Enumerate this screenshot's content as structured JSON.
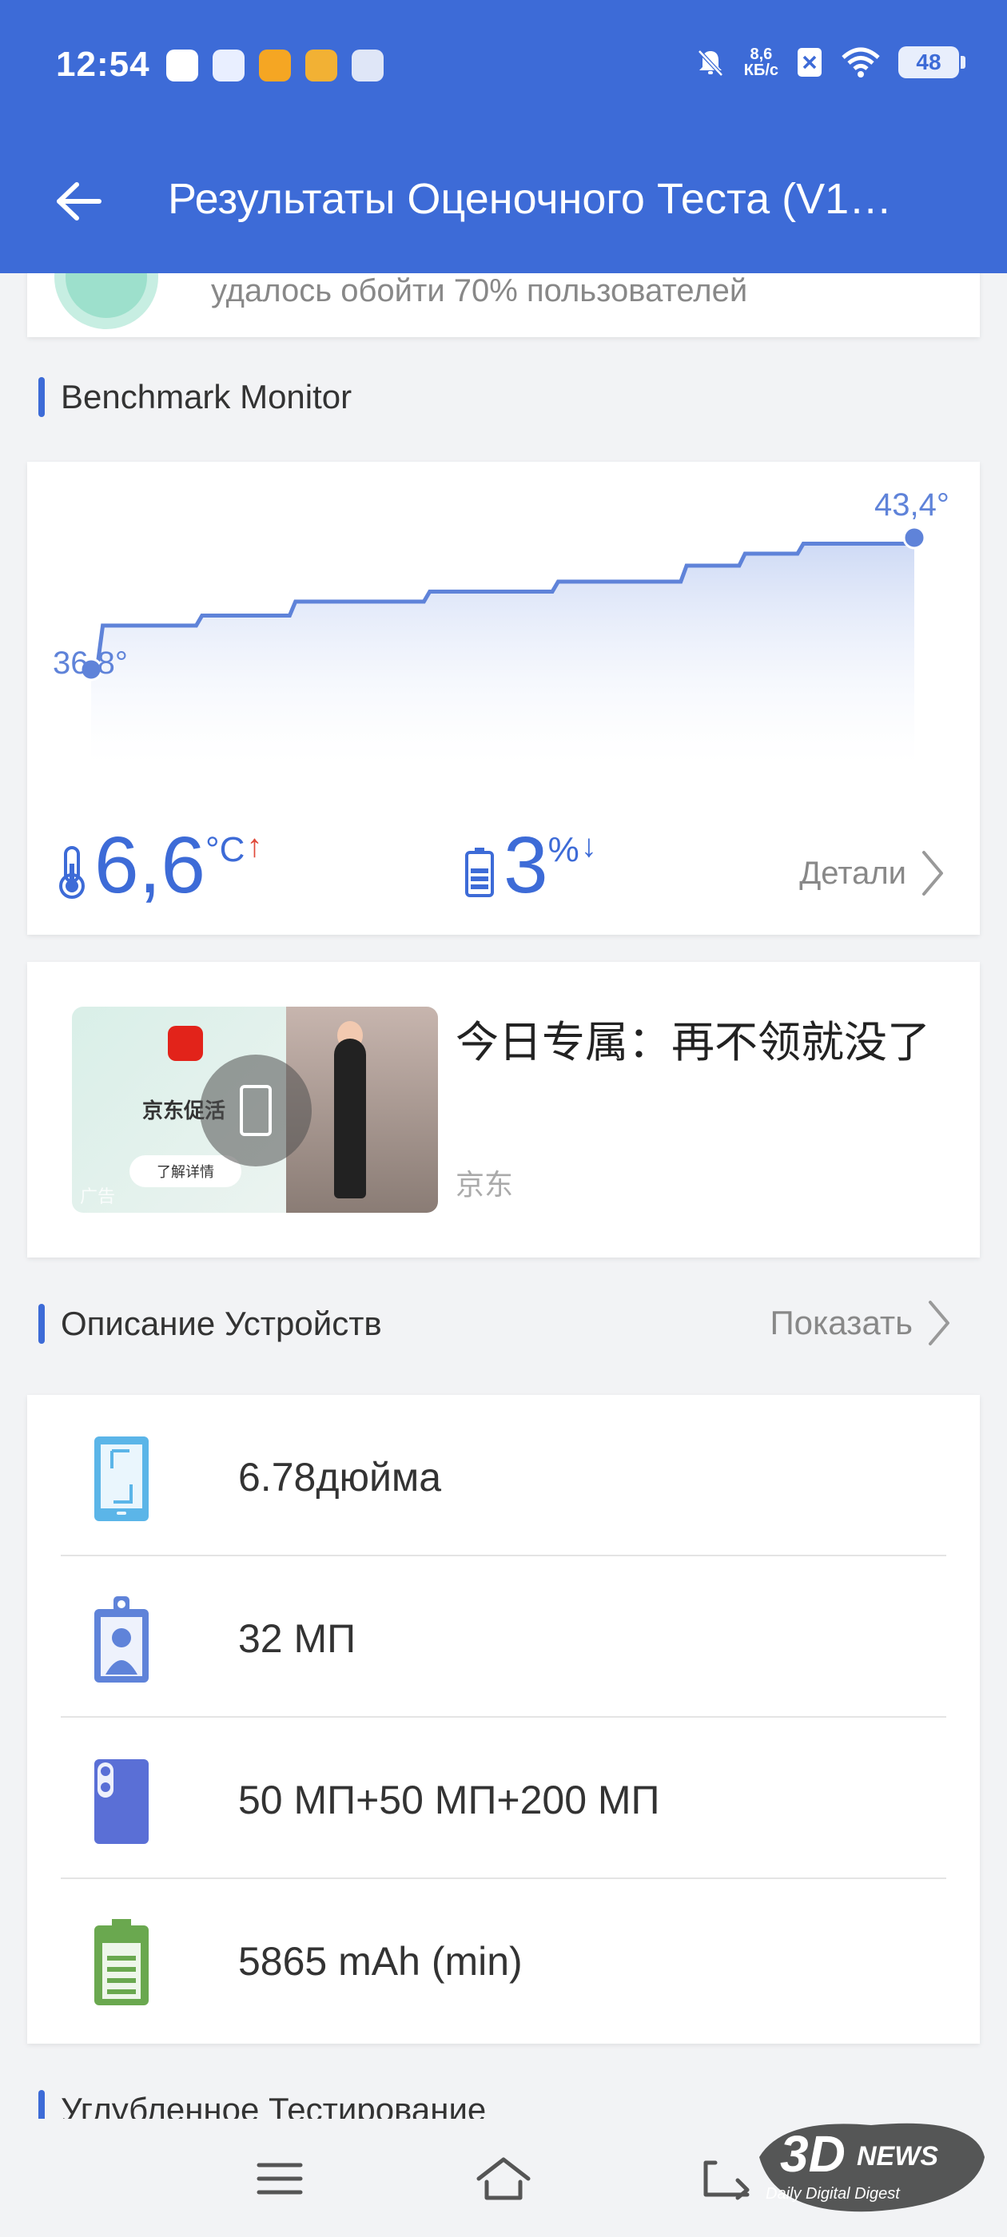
{
  "status_bar": {
    "time": "12:54",
    "net_speed_value": "8,6",
    "net_speed_unit": "КБ/с",
    "battery": "48"
  },
  "app_bar": {
    "title": "Результаты Оценочного Теста (V1…"
  },
  "score_card": {
    "text": "удалось обойти 70% пользователей"
  },
  "benchmark": {
    "header": "Benchmark Monitor",
    "start_temp_label": "36,8°",
    "end_temp_label": "43,4°",
    "temp_rise": "6,6",
    "temp_unit": "°C",
    "temp_arrow": "↑",
    "battery_drop": "3",
    "battery_unit": "%",
    "battery_arrow": "↓",
    "details_label": "Детали"
  },
  "chart_data": {
    "type": "area",
    "series": [
      {
        "values": [
          36.8,
          36.8,
          39.0,
          39.0,
          39.0,
          39.0,
          39.0,
          39.0,
          39.0,
          39.0,
          39.0,
          39.0,
          39.0,
          39.0,
          39.0,
          39.0,
          39.0,
          39.0,
          39.0,
          39.5,
          39.5,
          39.5,
          39.5,
          39.5,
          39.5,
          39.5,
          39.5,
          39.5,
          39.5,
          39.5,
          39.5,
          39.5,
          39.5,
          39.5,
          39.5,
          40.2,
          40.2,
          40.2,
          40.2,
          40.2,
          40.2,
          40.2,
          40.2,
          40.2,
          40.2,
          40.2,
          40.2,
          40.2,
          40.2,
          40.2,
          40.2,
          40.2,
          40.2,
          40.2,
          40.2,
          40.2,
          40.2,
          40.2,
          40.7,
          40.7,
          40.7,
          40.7,
          40.7,
          40.7,
          40.7,
          40.7,
          40.7,
          40.7,
          40.7,
          40.7,
          40.7,
          40.7,
          40.7,
          40.7,
          40.7,
          40.7,
          40.7,
          40.7,
          40.7,
          40.7,
          41.2,
          41.2,
          41.2,
          41.2,
          41.2,
          41.2,
          41.2,
          41.2,
          41.2,
          41.2,
          41.2,
          41.2,
          41.2,
          41.2,
          41.2,
          41.2,
          41.2,
          41.2,
          41.2,
          41.2,
          41.2,
          41.2,
          42.0,
          42.0,
          42.0,
          42.0,
          42.0,
          42.0,
          42.0,
          42.0,
          42.0,
          42.0,
          42.6,
          42.6,
          42.6,
          42.6,
          42.6,
          42.6,
          42.6,
          42.6,
          42.6,
          42.6,
          43.1,
          43.1,
          43.1,
          43.1,
          43.1,
          43.1,
          43.1,
          43.1,
          43.1,
          43.1,
          43.1,
          43.1,
          43.1,
          43.1,
          43.1,
          43.1,
          43.1,
          43.1,
          43.1,
          43.4
        ]
      }
    ],
    "start_value": 36.8,
    "end_value": 43.4,
    "xlabel": "",
    "ylabel": "",
    "grid": false
  },
  "ad": {
    "title": "今日专属：再不领就没了",
    "source": "京东",
    "brand": "京东促活",
    "button": "了解详情",
    "mark": "广告"
  },
  "devices": {
    "header": "Описание Устройств",
    "show_label": "Показать",
    "items": [
      {
        "icon": "phone-screen-icon",
        "text": "6.78дюйма",
        "color": "#5bb5e8"
      },
      {
        "icon": "front-camera-icon",
        "text": "32 МП",
        "color": "#5f83d9"
      },
      {
        "icon": "rear-camera-icon",
        "text": "50 МП+50 МП+200 МП",
        "color": "#5a6fd6"
      },
      {
        "icon": "battery-icon",
        "text": "5865 mAh (min)",
        "color": "#6aa84f"
      }
    ]
  },
  "deep_test": {
    "header": "Углубленное Тестирование"
  },
  "colors": {
    "accent": "#3d6bd7",
    "chart_line": "#5f83d9",
    "temp_up": "#e04a3a"
  }
}
